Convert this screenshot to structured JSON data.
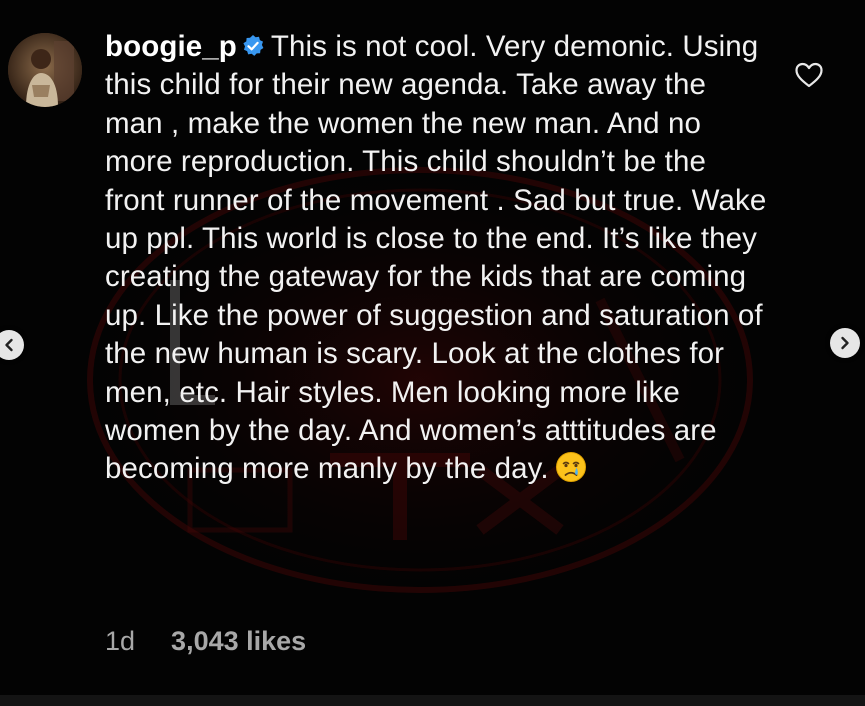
{
  "comment": {
    "username": "boogie_p",
    "verified": true,
    "text": "This is not cool. Very demonic. Using this child for their new agenda. Take away the man , make the women the new man. And no more reproduction. This child shouldn’t be the front runner of the movement . Sad but true. Wake up ppl. This world is close to the end. It’s like they creating the gateway for the kids that are coming up. Like the power of suggestion and saturation of the new human is scary. Look at the clothes for men, etc. Hair styles. Men looking more like women by the day. And women’s atttitudes are becoming more manly by the day.",
    "emoji": "crying-face",
    "age": "1d",
    "likes": "3,043 likes"
  },
  "icons": {
    "like": "heart-outline-icon",
    "verified": "verified-badge-icon",
    "prev": "chevron-left-icon",
    "next": "chevron-right-icon"
  },
  "colors": {
    "background": "#000000",
    "text": "#f2f2f2",
    "meta": "#a8a8a8",
    "verified_badge": "#3897f0",
    "watermark": "#5a0a0a"
  }
}
